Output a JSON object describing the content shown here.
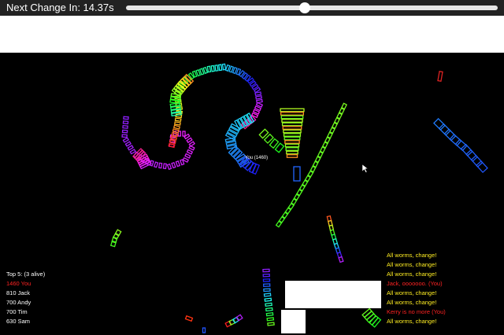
{
  "header": {
    "timer_text": "Next Change In: 14.37s",
    "slider_value": 0.48
  },
  "player_label": "You (1460)",
  "leaderboard": {
    "title": "Top 5: (3 alive)",
    "entries": [
      {
        "text": "1460 You",
        "color": "#ff2222"
      },
      {
        "text": "810 Jack",
        "color": "#ffffff"
      },
      {
        "text": "700 Andy",
        "color": "#ffffff"
      },
      {
        "text": "700 Tim",
        "color": "#ffffff"
      },
      {
        "text": "630 Sam",
        "color": "#ffffff"
      }
    ]
  },
  "messages": [
    {
      "text": "All worms, change!",
      "color": "#ffee22"
    },
    {
      "text": "All worms, change!",
      "color": "#ffee22"
    },
    {
      "text": "All worms, change!",
      "color": "#ffee22"
    },
    {
      "text": "Jack, ooooooo. (You)",
      "color": "#ff2222"
    },
    {
      "text": "All worms, change!",
      "color": "#ffee22"
    },
    {
      "text": "All worms, change!",
      "color": "#ffee22"
    },
    {
      "text": "Kerry is no more (You)",
      "color": "#ff2222"
    },
    {
      "text": "All worms, change!",
      "color": "#ffee22"
    }
  ],
  "colors": {
    "topbar": "#222222",
    "arena": "#000000",
    "you": "#ff2222",
    "announce": "#ffee22"
  }
}
